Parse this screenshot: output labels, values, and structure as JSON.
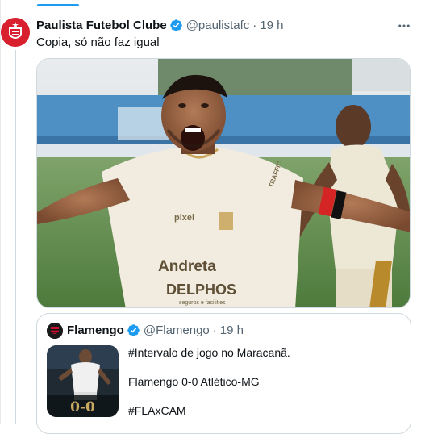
{
  "tweet": {
    "display_name": "Paulista Futebol Clube",
    "handle": "@paulistafc",
    "separator": "·",
    "time": "19 h",
    "text": "Copia, só não faz igual",
    "media_logos": {
      "sponsor1": "pixel",
      "sponsor2": "Andreta",
      "sponsor3": "DELPHOS",
      "sponsor3_sub": "seguros e facilities",
      "sleeve": "TRAFFIC"
    }
  },
  "quoted": {
    "display_name": "Flamengo",
    "handle": "@Flamengo",
    "separator": "·",
    "time": "19 h",
    "lines": [
      "#Intervalo de jogo no Maracanã.",
      "Flamengo 0-0 Atlético-MG",
      "#FLAxCAM"
    ],
    "thumb_score": "0-0"
  },
  "colors": {
    "verified": "#1d9bf0",
    "muted": "#536471",
    "border": "#cfd9de",
    "accent": "#1d9bf0"
  },
  "icons": [
    "verified-badge-icon",
    "more-options-icon"
  ]
}
